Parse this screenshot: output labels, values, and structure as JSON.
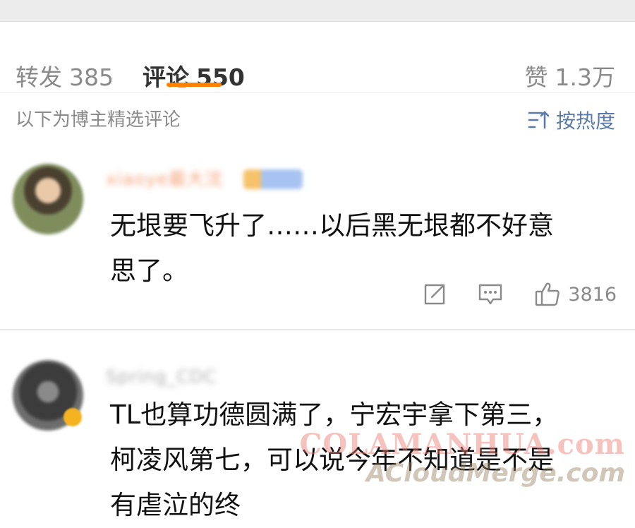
{
  "tabs": {
    "repost": {
      "label": "转发",
      "count": "385"
    },
    "comments": {
      "label": "评论",
      "count": "550"
    },
    "likes": {
      "label": "赞",
      "count": "1.3万"
    }
  },
  "subheader": {
    "featured_text": "以下为博主精选评论",
    "sort_label": "按热度"
  },
  "colors": {
    "accent": "#ff8200",
    "link": "#5b7aa8"
  },
  "comments": [
    {
      "username": "xiaoye最大沈",
      "text": "无垠要飞升了……以后黑无垠都不好意思了。",
      "like_count": "3816",
      "icons": [
        "share-icon",
        "comment-icon",
        "thumbs-up-icon"
      ]
    },
    {
      "username": "Spring_CDC",
      "text": "TL也算功德圆满了，宁宏宇拿下第三，柯凌风第七，可以说今年不知道是不是有虐泣的终"
    }
  ],
  "watermark": {
    "line1": "COLAMANHUA.com",
    "line2": "ACloudMerge.com"
  }
}
